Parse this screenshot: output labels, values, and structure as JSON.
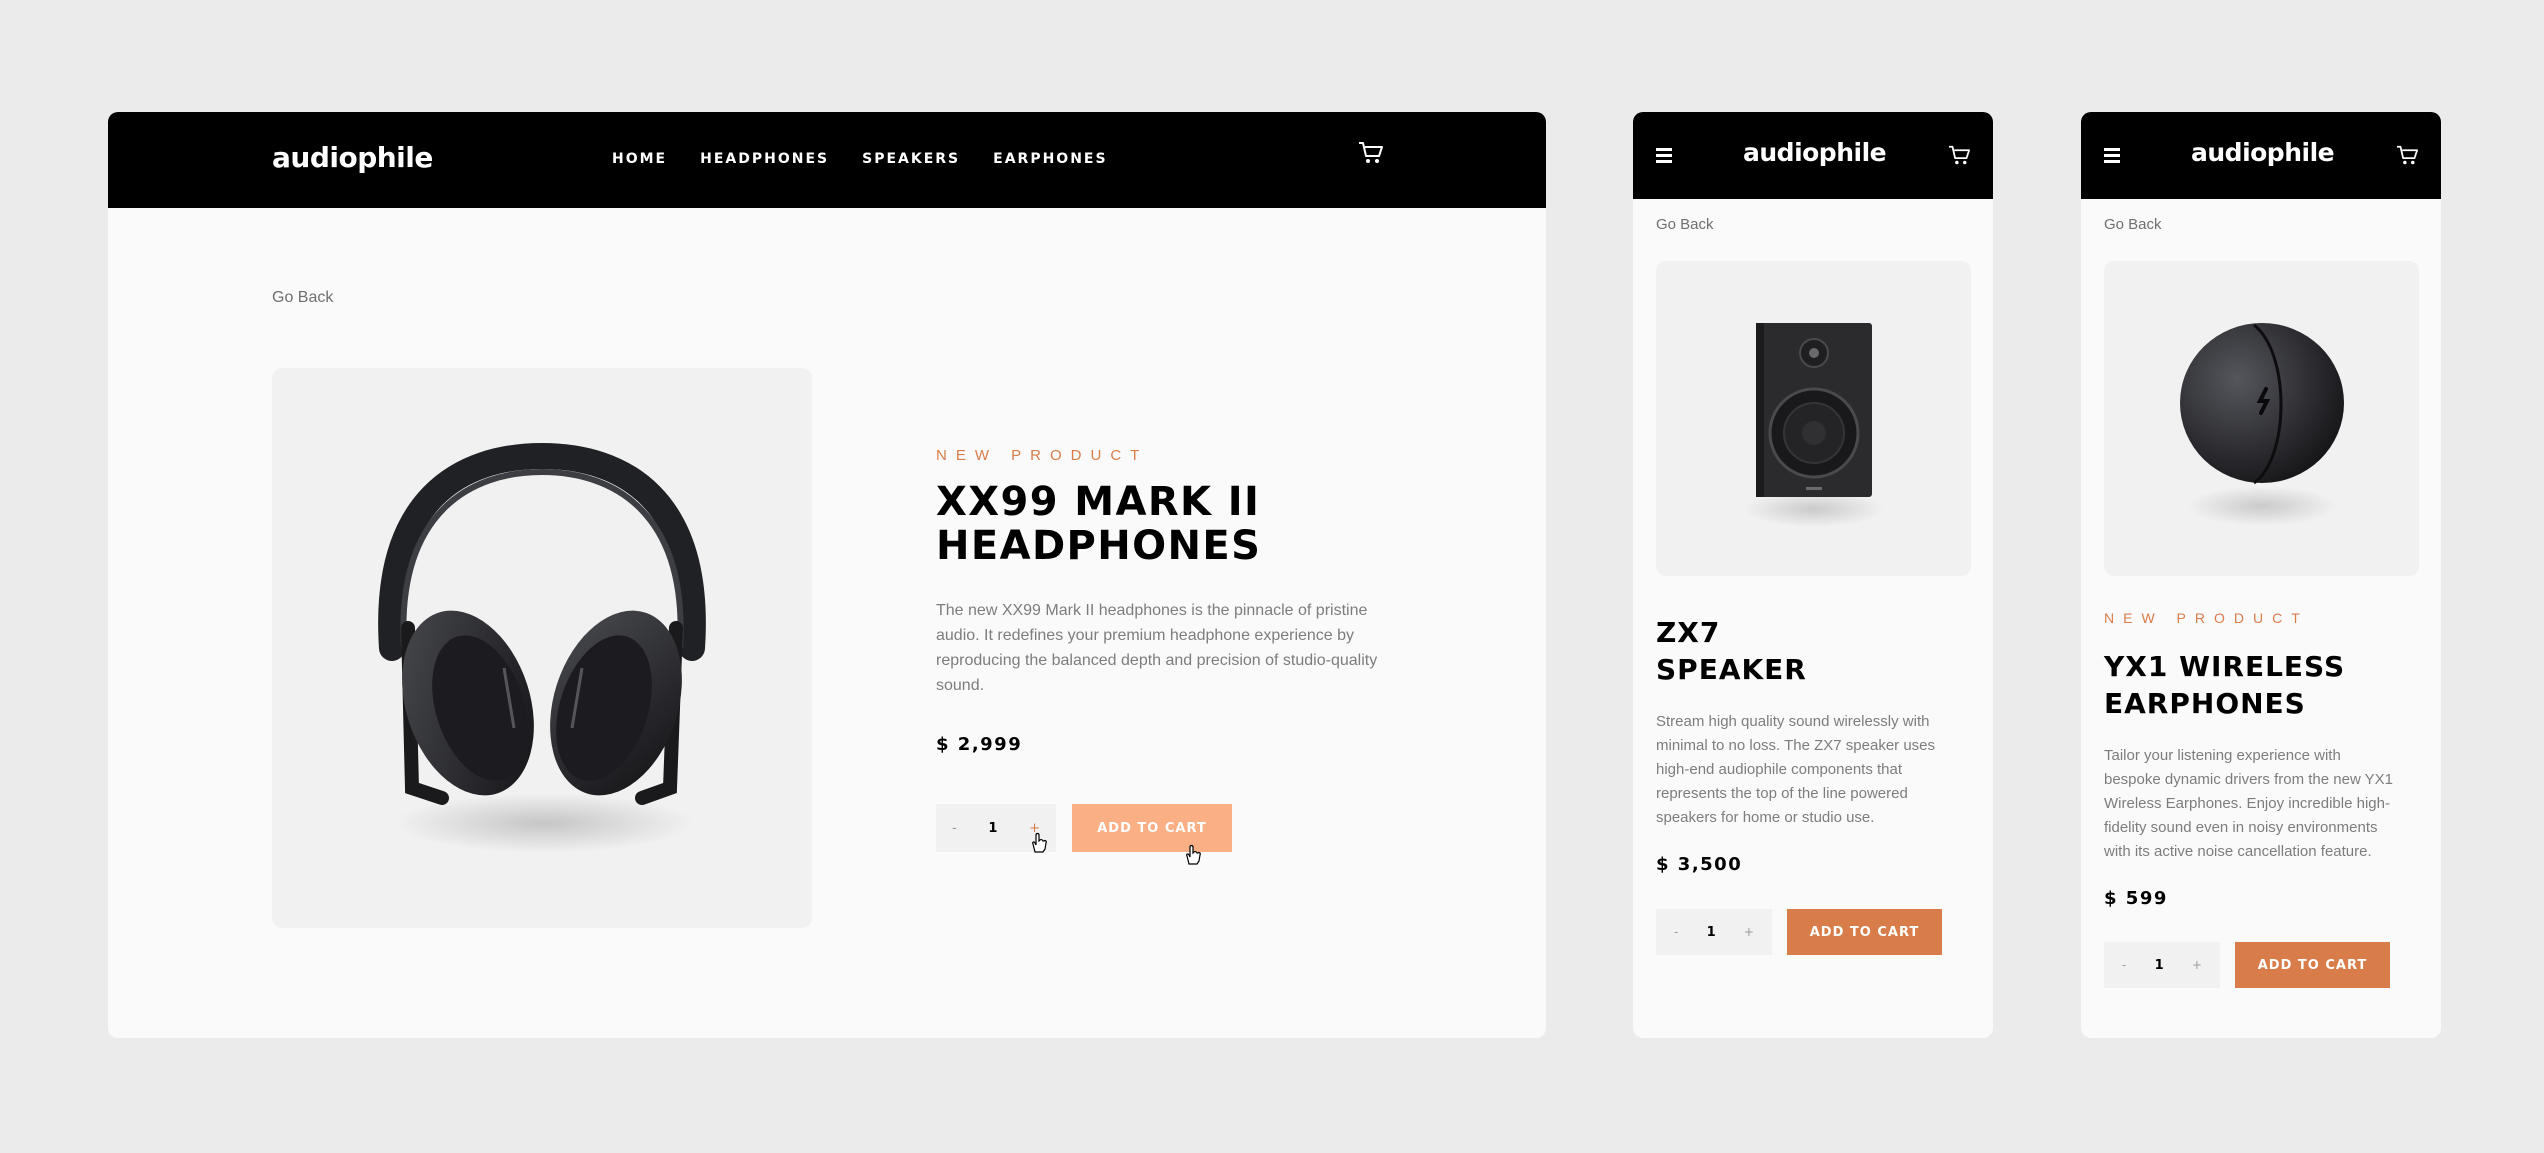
{
  "colors": {
    "accent": "#d87d4a",
    "accent_hover": "#fbaf85",
    "header": "#000000"
  },
  "desktop": {
    "logo": "audiophile",
    "nav": [
      "HOME",
      "HEADPHONES",
      "SPEAKERS",
      "EARPHONES"
    ],
    "cart_icon": "cart-icon",
    "go_back": "Go Back",
    "product": {
      "overline": "NEW PRODUCT",
      "title_lines": [
        "XX99 MARK II",
        "HEADPHONES"
      ],
      "description": "The new XX99 Mark II headphones is the pinnacle of pristine audio. It redefines your premium headphone experience by reproducing the balanced depth and precision of studio-quality sound.",
      "price": "$ 2,999",
      "quantity": {
        "minus": "-",
        "value": "1",
        "plus": "+"
      },
      "add_to_cart": "ADD TO CART"
    }
  },
  "mobile_speaker": {
    "logo": "audiophile",
    "menu_icon": "hamburger-icon",
    "cart_icon": "cart-icon",
    "go_back": "Go Back",
    "product": {
      "title_lines": [
        "ZX7",
        "SPEAKER"
      ],
      "description": "Stream high quality sound wirelessly with minimal to no loss. The ZX7 speaker uses high-end audiophile components that represents the top of the line powered speakers for home or studio use.",
      "price": "$ 3,500",
      "quantity": {
        "minus": "-",
        "value": "1",
        "plus": "+"
      },
      "add_to_cart": "ADD TO CART"
    }
  },
  "mobile_earphones": {
    "logo": "audiophile",
    "menu_icon": "hamburger-icon",
    "cart_icon": "cart-icon",
    "go_back": "Go Back",
    "product": {
      "overline": "NEW PRODUCT",
      "title_lines": [
        "YX1 WIRELESS",
        "EARPHONES"
      ],
      "description": "Tailor your listening experience with bespoke dynamic drivers from the new YX1 Wireless Earphones. Enjoy incredible high-fidelity sound even in noisy environments with its active noise cancellation feature.",
      "price": "$ 599",
      "quantity": {
        "minus": "-",
        "value": "1",
        "plus": "+"
      },
      "add_to_cart": "ADD TO CART"
    }
  }
}
